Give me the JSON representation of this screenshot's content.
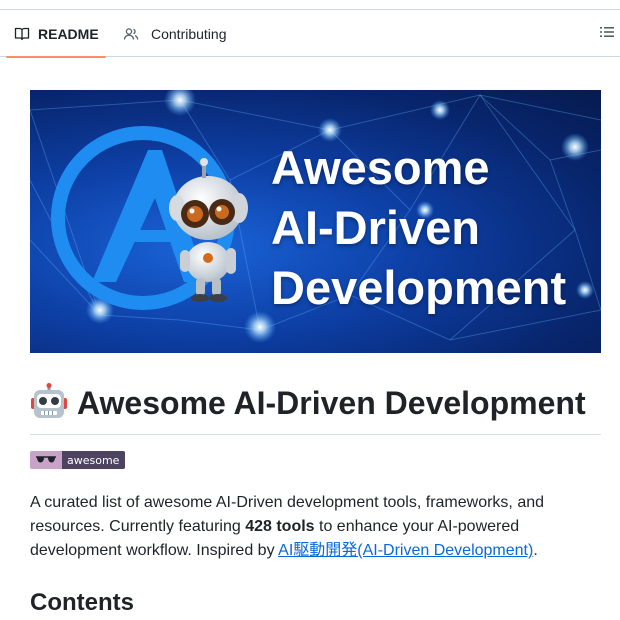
{
  "tabs": [
    {
      "label": "README",
      "icon": "book-icon",
      "active": true
    },
    {
      "label": "Contributing",
      "icon": "people-icon",
      "active": false
    }
  ],
  "outline_icon": "list-icon",
  "banner": {
    "title_lines": [
      "Awesome",
      "AI-Driven",
      "Development"
    ]
  },
  "heading": {
    "emoji": "robot-icon",
    "text": "Awesome AI-Driven Development"
  },
  "badge": {
    "text": "awesome",
    "colors": {
      "left": "#c9a3c7",
      "right": "#4d4360"
    }
  },
  "intro": {
    "text_before": "A curated list of awesome AI-Driven development tools, frameworks, and resources. Currently featuring ",
    "bold": "428 tools",
    "text_middle": " to enhance your AI-powered development workflow. Inspired by ",
    "link": "AI駆動開発(AI-Driven Development)",
    "text_after": "."
  },
  "contents_heading": "Contents",
  "colors": {
    "accent_underline": "#fd8c73",
    "link": "#0969da",
    "text": "#1f2328"
  }
}
